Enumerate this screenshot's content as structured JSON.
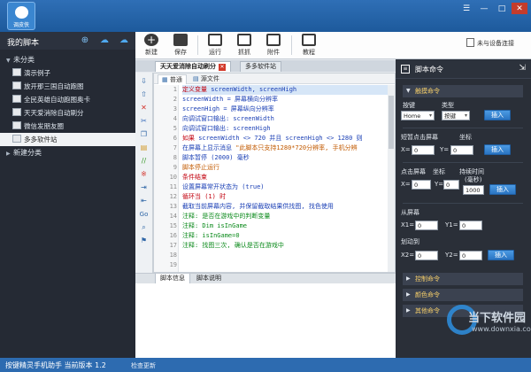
{
  "app": {
    "logo_label": "调皮侠",
    "window_buttons": [
      "☰",
      "—",
      "□",
      "✕"
    ]
  },
  "sidebar": {
    "title": "我的脚本",
    "groups": [
      {
        "label": "未分类",
        "expanded": true
      },
      {
        "label": "新建分类",
        "expanded": false
      }
    ],
    "items": [
      "演示例子",
      "放开那三国自动跑图",
      "全民英雄自动跑图奥卡",
      "天天爱消除自动刷分",
      "微信发朋友圈",
      "多多软件站"
    ],
    "selected_index": 5
  },
  "toolbar": {
    "buttons": [
      {
        "label": "新建",
        "icon": "plus-icon"
      },
      {
        "label": "保存",
        "icon": "save-icon"
      },
      {
        "label": "运行",
        "icon": "run-icon"
      },
      {
        "label": "抓抓",
        "icon": "capture-icon"
      },
      {
        "label": "附件",
        "icon": "attachment-icon"
      },
      {
        "label": "教程",
        "icon": "tutorial-icon"
      }
    ],
    "remote_status": "未与设备连接"
  },
  "tabs": [
    {
      "label": "天天爱消除自动刷分",
      "active": true,
      "closable": true
    },
    {
      "label": "多多软件站",
      "active": false,
      "closable": false
    }
  ],
  "editor": {
    "view_tabs": [
      "普通",
      "源文件"
    ],
    "active_view": 0,
    "line_numbers": [
      "1",
      "2",
      "3",
      "4",
      "5",
      "6",
      "7",
      "8",
      "9",
      "10",
      "11",
      "12",
      "13",
      "14",
      "15",
      "16",
      "17",
      "18",
      "19"
    ],
    "lines": [
      {
        "tokens": [
          {
            "t": "定义变量 ",
            "c": "kw"
          },
          {
            "t": "screenWidth, screenHigh",
            "c": "fn"
          }
        ],
        "highlight": true
      },
      {
        "tokens": [
          {
            "t": "screenWidth = 屏幕横向分辨率",
            "c": "fn"
          }
        ]
      },
      {
        "tokens": [
          {
            "t": "screenHigh = 屏幕纵向分辨率",
            "c": "fn"
          }
        ]
      },
      {
        "tokens": [
          {
            "t": "向调试窗口输出: screenWidth",
            "c": "fn"
          }
        ]
      },
      {
        "tokens": [
          {
            "t": "向调试窗口输出: screenHigh",
            "c": "fn"
          }
        ]
      },
      {
        "tokens": [
          {
            "t": "如果 ",
            "c": "kw"
          },
          {
            "t": "screenWidth <> 720 并且 screenHigh <> 1280 则",
            "c": "fn"
          }
        ]
      },
      {
        "tokens": [
          {
            "t": "    在屏幕上显示消息 ",
            "c": "fn"
          },
          {
            "t": "\"此脚本只支持1280*720分辨率, 手机分辨",
            "c": "str"
          }
        ]
      },
      {
        "tokens": [
          {
            "t": "    脚本暂停 (2000) 毫秒",
            "c": "fn"
          }
        ]
      },
      {
        "tokens": [
          {
            "t": "    脚本停止运行",
            "c": "str"
          }
        ]
      },
      {
        "tokens": [
          {
            "t": "条件结束",
            "c": "kw"
          }
        ]
      },
      {
        "tokens": [
          {
            "t": "设置屏幕常开状态为 (true)",
            "c": "fn"
          }
        ]
      },
      {
        "tokens": [
          {
            "t": "循环当 (1) 时",
            "c": "kw"
          }
        ]
      },
      {
        "tokens": [
          {
            "t": "    截取当前屏幕内容, 并保留截取结果供找图, 找色使用",
            "c": "fn"
          }
        ]
      },
      {
        "tokens": [
          {
            "t": "    注释: 是否在游戏中的判断变量",
            "c": "cm"
          }
        ]
      },
      {
        "tokens": [
          {
            "t": "    注释:     Dim isInGame",
            "c": "cm"
          }
        ]
      },
      {
        "tokens": [
          {
            "t": "    注释:     isInGame=0",
            "c": "cm"
          }
        ]
      },
      {
        "tokens": [
          {
            "t": "    注释: 找图三次, 确认是否在游戏中",
            "c": "cm"
          }
        ]
      },
      {
        "tokens": [
          {
            "t": "",
            "c": "pl"
          }
        ]
      },
      {
        "tokens": [
          {
            "t": "",
            "c": "pl"
          }
        ]
      }
    ]
  },
  "bottom_tabs": [
    "脚本信息",
    "脚本说明"
  ],
  "right_panel": {
    "title": "脚本命令",
    "sections": {
      "touch": "触摸命令",
      "control": "控制命令",
      "color": "颜色命令",
      "other": "其他命令"
    },
    "key_label": "按键",
    "type_label": "类型",
    "key_value": "Home",
    "type_value": "按键",
    "insert": "插入",
    "tap_label": "短暂点击屏幕",
    "coord_label": "坐标",
    "x_label": "X=",
    "y_label": "Y=",
    "x_value": "0",
    "y_value": "0",
    "long_press_label": "点击屏幕",
    "long_coord_label": "坐标",
    "hold_label": "持续时间",
    "hold_unit": "(毫秒)",
    "hold_value": "1000",
    "from_label": "从屏幕",
    "x1_label": "X1=",
    "y1_label": "Y1=",
    "x1_value": "0",
    "y1_value": "0",
    "to_label": "划动到",
    "x2_label": "X2=",
    "y2_label": "Y2=",
    "x2_value": "0",
    "y2_value": "0"
  },
  "status": {
    "version": "按键精灵手机助手 当前版本 1.2",
    "update": "检查更新"
  },
  "watermark": {
    "text": "当下软件园",
    "url": "www.downxia.com"
  }
}
